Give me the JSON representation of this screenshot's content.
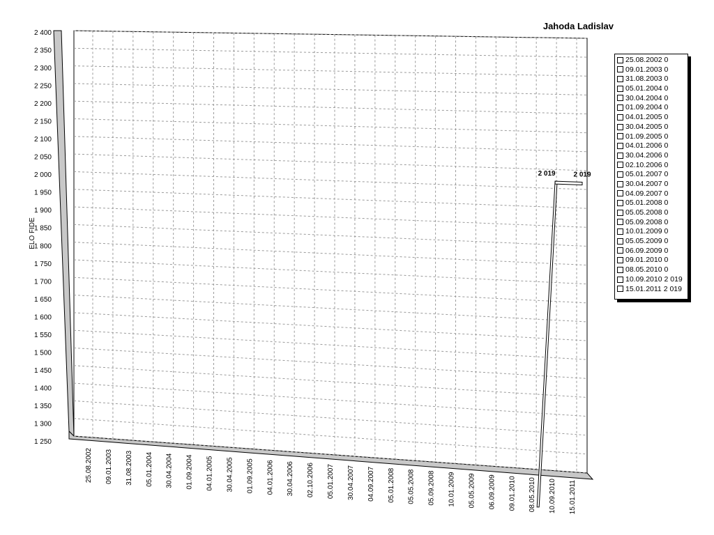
{
  "chart_data": {
    "type": "line",
    "title": "Jahoda Ladislav",
    "ylabel": "ELO FIDE",
    "xlabel": "",
    "ylim": [
      1250,
      2400
    ],
    "ytick_step": 50,
    "ytick_labels": [
      "1 250",
      "1 300",
      "1 350",
      "1 400",
      "1 450",
      "1 500",
      "1 550",
      "1 600",
      "1 650",
      "1 700",
      "1 750",
      "1 800",
      "1 850",
      "1 900",
      "1 950",
      "2 000",
      "2 050",
      "2 100",
      "2 150",
      "2 200",
      "2 250",
      "2 300",
      "2 350",
      "2 400"
    ],
    "categories": [
      "25.08.2002",
      "09.01.2003",
      "31.08.2003",
      "05.01.2004",
      "30.04.2004",
      "01.09.2004",
      "04.01.2005",
      "30.04.2005",
      "01.09.2005",
      "04.01.2006",
      "30.04.2006",
      "02.10.2006",
      "05.01.2007",
      "30.04.2007",
      "04.09.2007",
      "05.01.2008",
      "05.05.2008",
      "05.09.2008",
      "10.01.2009",
      "05.05.2009",
      "06.09.2009",
      "09.01.2010",
      "08.05.2010",
      "10.09.2010",
      "15.01.2011"
    ],
    "series": [
      {
        "values": [
          0,
          0,
          0,
          0,
          0,
          0,
          0,
          0,
          0,
          0,
          0,
          0,
          0,
          0,
          0,
          0,
          0,
          0,
          0,
          0,
          0,
          0,
          0,
          2019,
          2019
        ]
      }
    ],
    "data_labels": [
      "2 019",
      "2 019"
    ],
    "legend": {
      "placement": "right",
      "entries": [
        "25.08.2002 0",
        "09.01.2003 0",
        "31.08.2003 0",
        "05.01.2004 0",
        "30.04.2004 0",
        "01.09.2004 0",
        "04.01.2005 0",
        "30.04.2005 0",
        "01.09.2005 0",
        "04.01.2006 0",
        "30.04.2006 0",
        "02.10.2006 0",
        "05.01.2007 0",
        "30.04.2007 0",
        "04.09.2007 0",
        "05.01.2008 0",
        "05.05.2008 0",
        "05.09.2008 0",
        "10.01.2009 0",
        "05.05.2009 0",
        "06.09.2009 0",
        "09.01.2010 0",
        "08.05.2010 0",
        "10.09.2010 2 019",
        "15.01.2011 2 019"
      ]
    },
    "grid": true,
    "style": "3d"
  }
}
